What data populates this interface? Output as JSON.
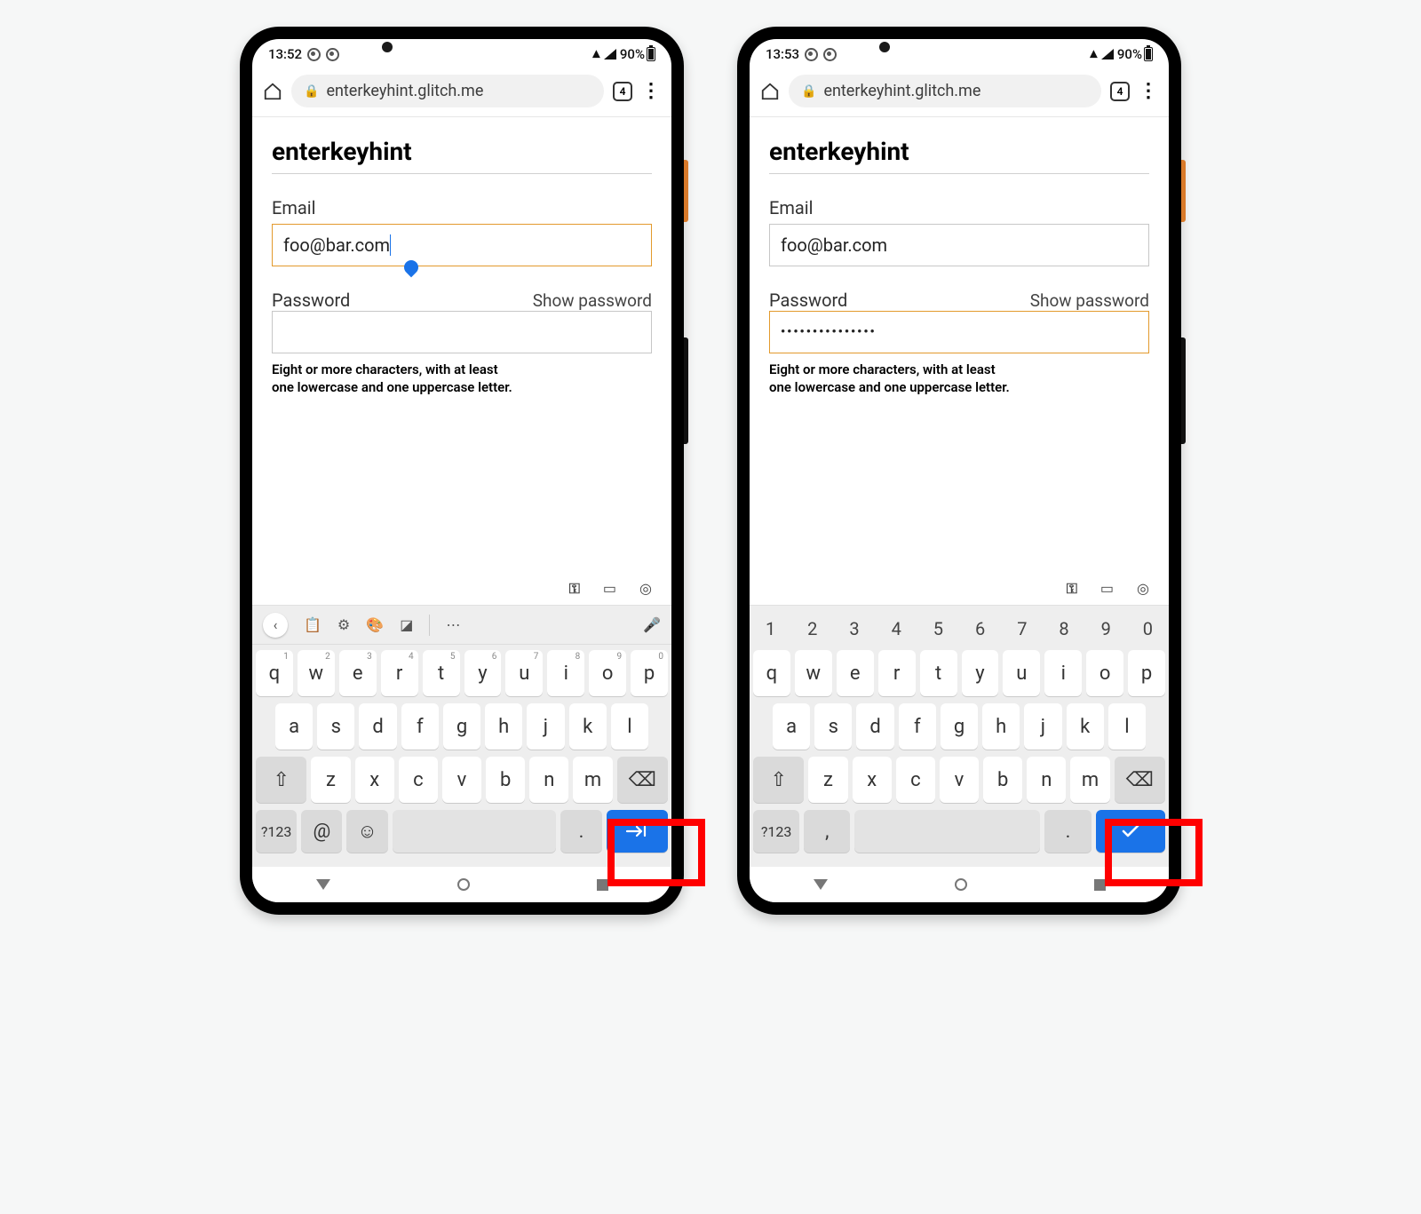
{
  "phones": [
    {
      "status": {
        "time": "13:52",
        "battery": "90%"
      },
      "browser": {
        "url": "enterkeyhint.glitch.me",
        "tab_count": "4"
      },
      "page": {
        "heading": "enterkeyhint",
        "email_label": "Email",
        "email_value": "foo@bar.com",
        "email_focused": true,
        "password_label": "Password",
        "show_password": "Show password",
        "password_value": "",
        "password_focused": false,
        "hint_line1": "Eight or more characters, with at least",
        "hint_line2": "one lowercase and one uppercase letter."
      },
      "keyboard": {
        "has_number_row": false,
        "toolbar": [
          "chevron-left",
          "clipboard",
          "gear",
          "palette",
          "sticker",
          "sep",
          "more",
          "mic-off"
        ],
        "row1": [
          {
            "k": "q",
            "s": "1"
          },
          {
            "k": "w",
            "s": "2"
          },
          {
            "k": "e",
            "s": "3"
          },
          {
            "k": "r",
            "s": "4"
          },
          {
            "k": "t",
            "s": "5"
          },
          {
            "k": "y",
            "s": "6"
          },
          {
            "k": "u",
            "s": "7"
          },
          {
            "k": "i",
            "s": "8"
          },
          {
            "k": "o",
            "s": "9"
          },
          {
            "k": "p",
            "s": "0"
          }
        ],
        "row2": [
          "a",
          "s",
          "d",
          "f",
          "g",
          "h",
          "j",
          "k",
          "l"
        ],
        "row3": [
          "z",
          "x",
          "c",
          "v",
          "b",
          "n",
          "m"
        ],
        "bottom": {
          "sym": "?123",
          "extra1": "@",
          "extra2_icon": "emoji",
          "period": ".",
          "enter_icon": "next-arrow"
        }
      }
    },
    {
      "status": {
        "time": "13:53",
        "battery": "90%"
      },
      "browser": {
        "url": "enterkeyhint.glitch.me",
        "tab_count": "4"
      },
      "page": {
        "heading": "enterkeyhint",
        "email_label": "Email",
        "email_value": "foo@bar.com",
        "email_focused": false,
        "password_label": "Password",
        "show_password": "Show password",
        "password_value": "•••••••••••••••",
        "password_focused": true,
        "hint_line1": "Eight or more characters, with at least",
        "hint_line2": "one lowercase and one uppercase letter."
      },
      "keyboard": {
        "has_number_row": true,
        "numbers": [
          "1",
          "2",
          "3",
          "4",
          "5",
          "6",
          "7",
          "8",
          "9",
          "0"
        ],
        "row1": [
          {
            "k": "q"
          },
          {
            "k": "w"
          },
          {
            "k": "e"
          },
          {
            "k": "r"
          },
          {
            "k": "t"
          },
          {
            "k": "y"
          },
          {
            "k": "u"
          },
          {
            "k": "i"
          },
          {
            "k": "o"
          },
          {
            "k": "p"
          }
        ],
        "row2": [
          "a",
          "s",
          "d",
          "f",
          "g",
          "h",
          "j",
          "k",
          "l"
        ],
        "row3": [
          "z",
          "x",
          "c",
          "v",
          "b",
          "n",
          "m"
        ],
        "bottom": {
          "sym": "?123",
          "extra1": ",",
          "period": ".",
          "enter_icon": "done-check"
        }
      }
    }
  ]
}
